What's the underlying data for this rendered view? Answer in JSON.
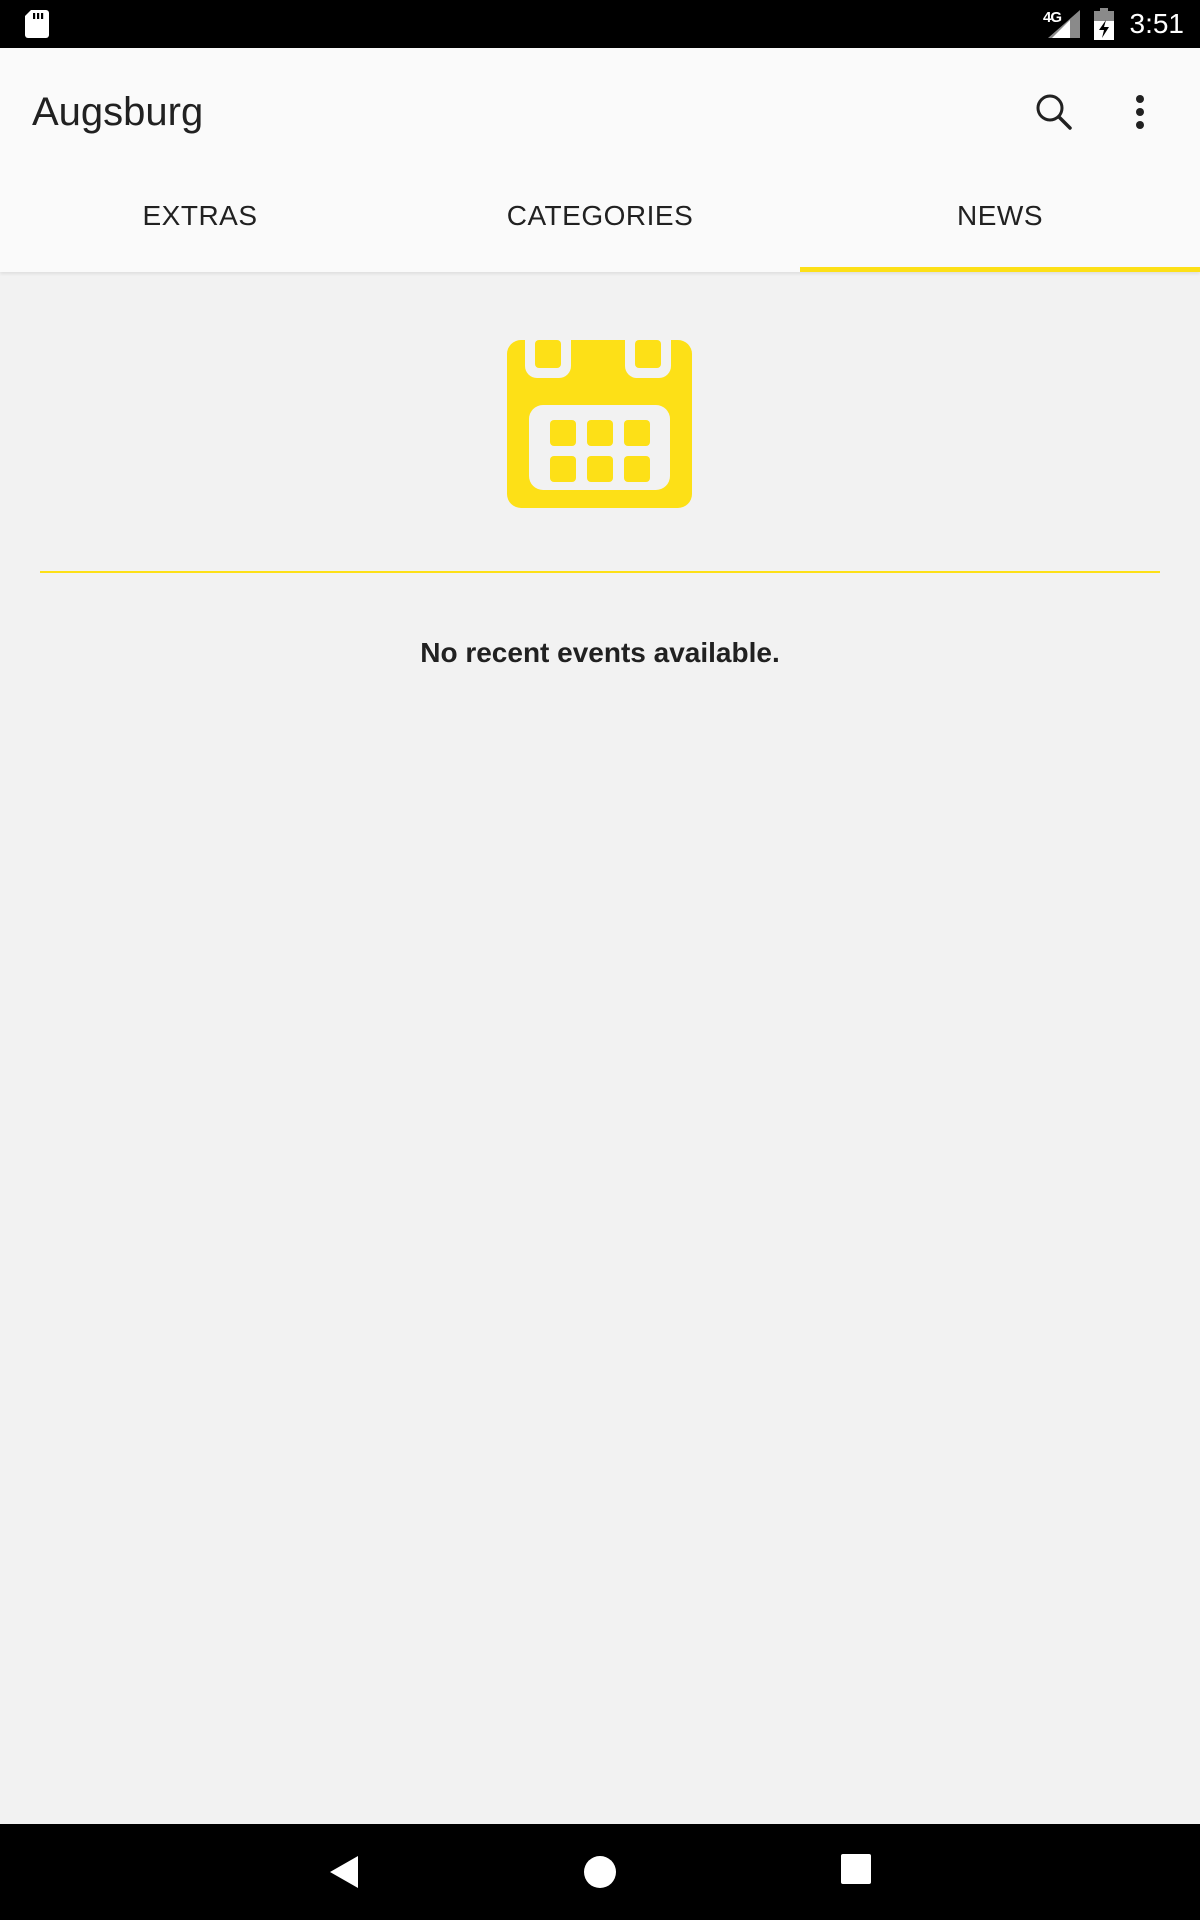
{
  "status_bar": {
    "network": "4G",
    "time": "3:51"
  },
  "app_bar": {
    "title": "Augsburg",
    "icons": [
      "search-icon",
      "more-vert-icon"
    ]
  },
  "tabs": [
    {
      "label": "EXTRAS",
      "active": false
    },
    {
      "label": "CATEGORIES",
      "active": false
    },
    {
      "label": "NEWS",
      "active": true
    }
  ],
  "content": {
    "icon": "calendar-icon",
    "message": "No recent events available."
  },
  "colors": {
    "accent": "#fde017",
    "background": "#f2f2f2",
    "app_bar": "#fafafa",
    "text": "#212121"
  },
  "nav_bar": {
    "icons": [
      "back-icon",
      "home-icon",
      "recents-icon"
    ]
  }
}
